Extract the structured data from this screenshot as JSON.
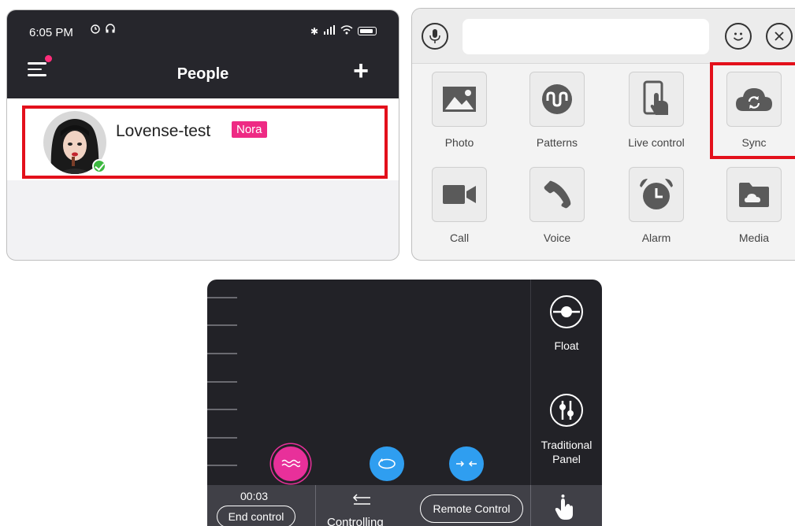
{
  "people_screen": {
    "status_time": "6:05 PM",
    "title": "People",
    "add_icon": "plus-icon",
    "menu_icon": "menu-icon",
    "contact": {
      "name": "Lovense-test",
      "tag": "Nora",
      "online": true
    },
    "colors": {
      "header": "#26262c",
      "tag": "#ee2a84",
      "highlight": "#e3101b",
      "online": "#3cb83f"
    }
  },
  "tools_screen": {
    "input_value": "",
    "left_icon": "microphone-icon",
    "right_icons": [
      "smiley-icon",
      "close-icon"
    ],
    "tools": [
      {
        "label": "Photo",
        "icon": "photo-icon"
      },
      {
        "label": "Patterns",
        "icon": "patterns-icon"
      },
      {
        "label": "Live control",
        "icon": "live-control-icon"
      },
      {
        "label": "Sync",
        "icon": "sync-icon"
      },
      {
        "label": "Call",
        "icon": "video-call-icon"
      },
      {
        "label": "Voice",
        "icon": "phone-icon"
      },
      {
        "label": "Alarm",
        "icon": "alarm-icon"
      },
      {
        "label": "Media",
        "icon": "folder-icon"
      }
    ],
    "highlighted_tool": "Sync"
  },
  "control_screen": {
    "side_buttons": [
      {
        "label": "Float",
        "icon": "float-icon"
      },
      {
        "label": "Traditional Panel",
        "icon": "sliders-icon"
      }
    ],
    "timer": "00:03",
    "end_control": "End control",
    "controlling": "Controlling",
    "remote_control": "Remote Control",
    "mode_colors": [
      "#e8309a",
      "#2f9ef0",
      "#2f9ef0"
    ]
  }
}
